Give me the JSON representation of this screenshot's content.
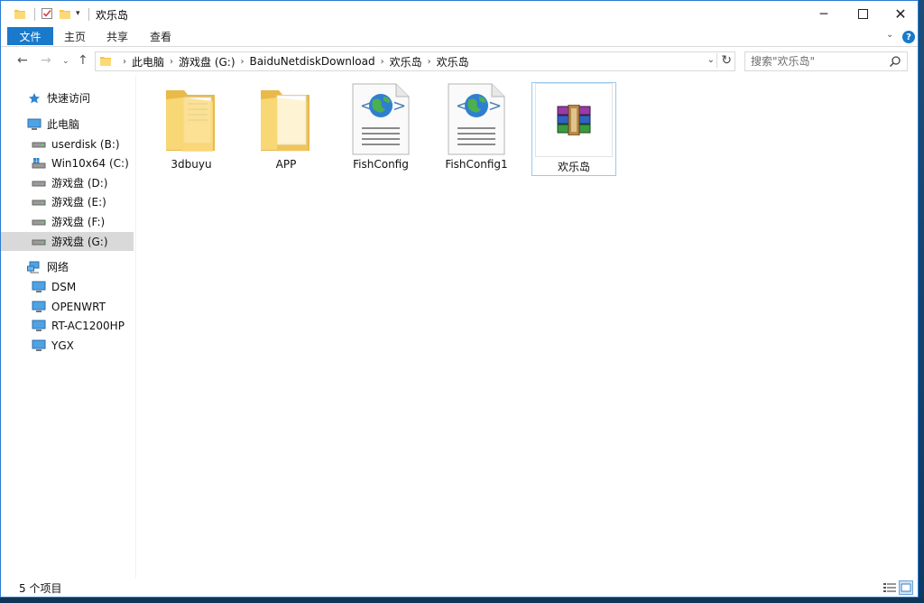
{
  "window": {
    "title": "欢乐岛"
  },
  "ribbon": {
    "file": "文件",
    "home": "主页",
    "share": "共享",
    "view": "查看",
    "help": "?"
  },
  "nav": {
    "breadcrumbs": [
      "此电脑",
      "游戏盘 (G:)",
      "BaiduNetdiskDownload",
      "欢乐岛",
      "欢乐岛"
    ],
    "search_placeholder": "搜索\"欢乐岛\""
  },
  "sidebar": {
    "quick_access": "快速访问",
    "this_pc": "此电脑",
    "drives": [
      {
        "label": "userdisk (B:)"
      },
      {
        "label": "Win10x64 (C:)"
      },
      {
        "label": "游戏盘 (D:)"
      },
      {
        "label": "游戏盘 (E:)"
      },
      {
        "label": "游戏盘 (F:)"
      },
      {
        "label": "游戏盘 (G:)",
        "selected": true
      }
    ],
    "network": "网络",
    "hosts": [
      {
        "label": "DSM"
      },
      {
        "label": "OPENWRT"
      },
      {
        "label": "RT-AC1200HP"
      },
      {
        "label": "YGX"
      }
    ]
  },
  "files": [
    {
      "name": "3dbuyu",
      "icon": "folder-with-docs-icon"
    },
    {
      "name": "APP",
      "icon": "folder-icon"
    },
    {
      "name": "FishConfig",
      "icon": "web-config-file-icon"
    },
    {
      "name": "FishConfig1",
      "icon": "web-config-file-icon"
    },
    {
      "name": "欢乐岛",
      "icon": "winrar-archive-icon",
      "selected": true
    }
  ],
  "status": {
    "count": "5 个项目"
  },
  "colors": {
    "accent": "#1979ca",
    "selection": "#d9d9d9",
    "window_border": "#2b7bd1"
  }
}
